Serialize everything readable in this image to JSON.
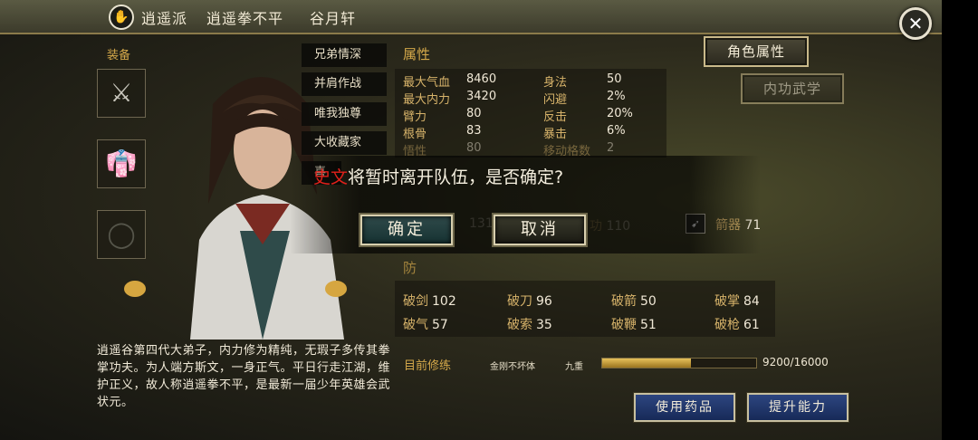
{
  "topbar": {
    "emblem_glyph": "✋",
    "sect": "逍遥派",
    "title": "逍遥拳不平",
    "name": "谷月轩",
    "close_glyph": "✕"
  },
  "equipment": {
    "title": "装备",
    "slots": [
      {
        "icon": "weapon-icon",
        "glyph": "⚔"
      },
      {
        "icon": "robe-icon",
        "glyph": "👘"
      },
      {
        "icon": "empty-slot-icon",
        "glyph": "◯"
      }
    ]
  },
  "brotherhood": [
    "兄弟情深",
    "并肩作战",
    "唯我独尊",
    "大收藏家",
    "喜"
  ],
  "tabs": {
    "character_attrs": "角色属性",
    "internal_skills": "内功武学"
  },
  "attributes": {
    "title": "属性",
    "rows": [
      {
        "k1": "最大气血",
        "v1": "8460",
        "k2": "身法",
        "v2": "50"
      },
      {
        "k1": "最大内力",
        "v1": "3420",
        "k2": "闪避",
        "v2": "2%"
      },
      {
        "k1": "臂力",
        "v1": "80",
        "k2": "反击",
        "v2": "20%"
      },
      {
        "k1": "根骨",
        "v1": "83",
        "k2": "暴击",
        "v2": "6%"
      },
      {
        "k1": "悟性",
        "v1": "80",
        "k2": "移动格数",
        "v2": "2"
      }
    ]
  },
  "attack_row": {
    "left_value": "131",
    "mid_label": "功",
    "mid_value": "110",
    "right_label": "箭器",
    "right_value": "71"
  },
  "dialog": {
    "name": "史文",
    "message": "将暂时离开队伍，是否确定?",
    "confirm": "确定",
    "cancel": "取消"
  },
  "defense": {
    "title": "防",
    "rows": [
      [
        {
          "k": "破剑",
          "v": "102"
        },
        {
          "k": "破刀",
          "v": "96"
        },
        {
          "k": "破箭",
          "v": "50"
        },
        {
          "k": "破掌",
          "v": "84"
        }
      ],
      [
        {
          "k": "破气",
          "v": "57"
        },
        {
          "k": "破索",
          "v": "35"
        },
        {
          "k": "破鞭",
          "v": "51"
        },
        {
          "k": "破枪",
          "v": "61"
        }
      ]
    ]
  },
  "description": "逍遥谷第四代大弟子，内力修为精纯，无瑕子多传其拳掌功夫。为人端方斯文，一身正气。平日行走江湖，维护正义，故人称逍遥拳不平，是最新一届少年英雄会武状元。",
  "cultivation": {
    "label": "目前修练",
    "skill": "金刚不坏体",
    "level": "九重",
    "progress": "9200/16000",
    "progress_fraction": 0.575
  },
  "actions": {
    "use_medicine": "使用药品",
    "improve_ability": "提升能力"
  },
  "colors": {
    "accent_gold": "#d4a84a",
    "dialog_name_red": "#e0201a",
    "action_blue": "#2d4580"
  }
}
